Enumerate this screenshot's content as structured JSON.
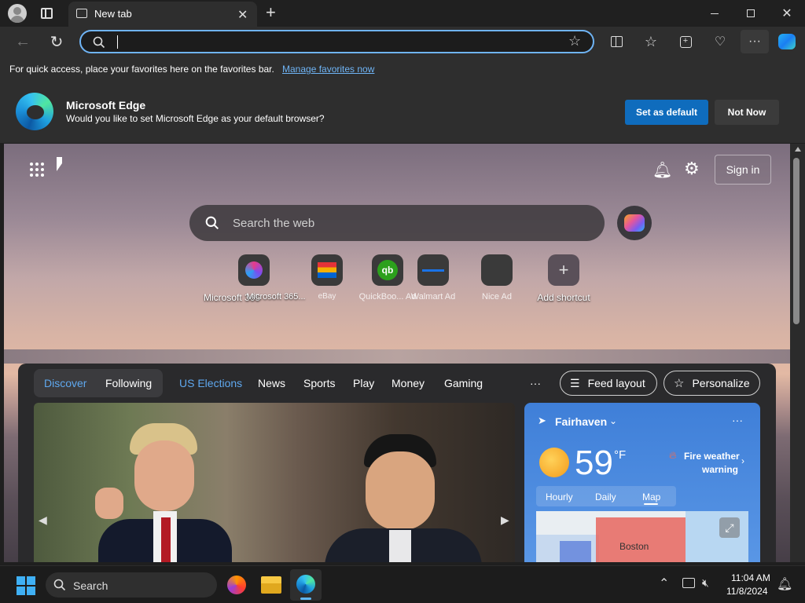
{
  "tab": {
    "title": "New tab"
  },
  "addressbar": {
    "value": "",
    "placeholder": ""
  },
  "favbar": {
    "text": "For quick access, place your favorites here on the favorites bar.",
    "link": "Manage favorites now"
  },
  "infobar": {
    "title": "Microsoft Edge",
    "message": "Would you like to set Microsoft Edge as your default browser?",
    "set_default": "Set as default",
    "not_now": "Not Now"
  },
  "page": {
    "sign_in": "Sign in",
    "search_placeholder": "Search the web",
    "shortcuts": [
      {
        "label": "Microsoft 365"
      },
      {
        "label": "Microsoft 365..."
      },
      {
        "label": "eBay"
      },
      {
        "label": "QuickBoo... Ad"
      },
      {
        "label": "Walmart Ad"
      },
      {
        "label": "Nice Ad"
      },
      {
        "label": "Add shortcut"
      }
    ],
    "nav": {
      "discover": "Discover",
      "following": "Following",
      "us_elections": "US Elections",
      "news": "News",
      "sports": "Sports",
      "play": "Play",
      "money": "Money",
      "gaming": "Gaming",
      "more": "···",
      "feed_layout": "Feed layout",
      "personalize": "Personalize"
    },
    "weather": {
      "location": "Fairhaven",
      "temp": "59",
      "unit": "°F",
      "alert_line1": "Fire weather",
      "alert_line2": "warning",
      "tabs": [
        "Hourly",
        "Daily",
        "Map"
      ],
      "map_label": "Boston"
    }
  },
  "taskbar": {
    "search": "Search",
    "time": "11:04 AM",
    "date": "11/8/2024"
  },
  "colors": {
    "accent": "#0f6cbd",
    "link": "#6fb4f5",
    "nav_active": "#5fa8ef"
  }
}
